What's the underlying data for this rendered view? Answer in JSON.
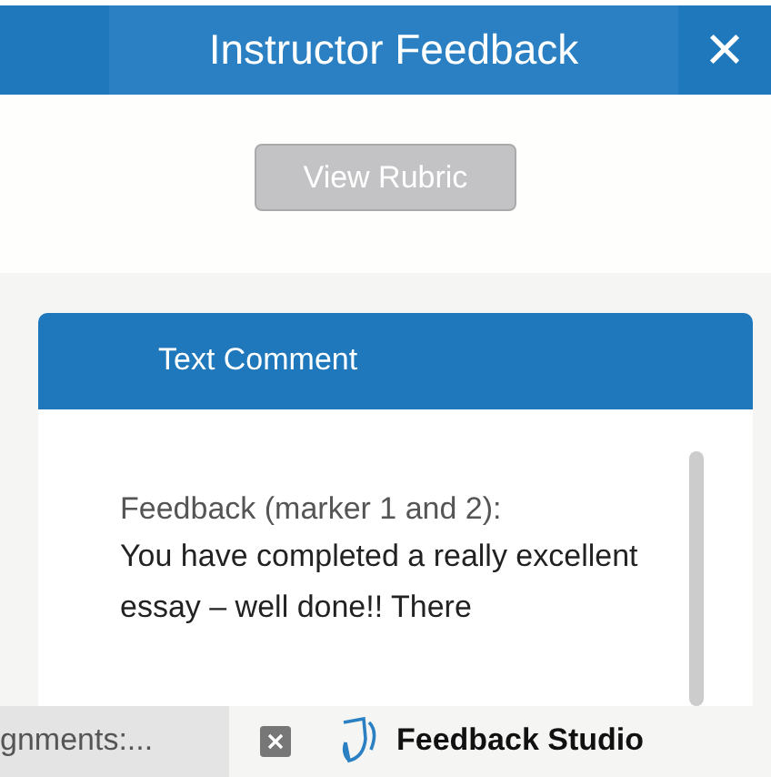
{
  "header": {
    "title": "Instructor Feedback",
    "close": "×"
  },
  "rubric_button": {
    "label": "View Rubric",
    "disabled": true
  },
  "comment_panel": {
    "title": "Text Comment",
    "label": "Feedback (marker 1 and 2):",
    "body": "You have completed a really excellent essay – well done!! There"
  },
  "tab_bar": {
    "tabs": [
      {
        "label": "gnments:...",
        "selected": false
      },
      {
        "label": "Feedback Studio",
        "selected": true
      }
    ]
  }
}
